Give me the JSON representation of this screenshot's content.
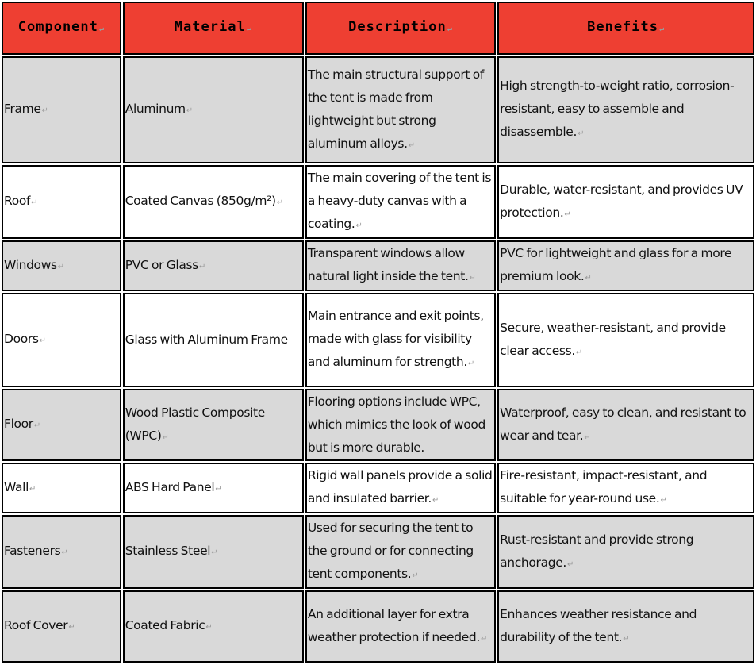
{
  "table": {
    "header_color": "#EE3F32",
    "row_colors": {
      "gray": "#D9D9D9",
      "white": "#FFFFFF"
    },
    "columns": [
      "Component",
      "Material",
      "Description",
      "Benefits"
    ],
    "rows": [
      {
        "shade": "gray",
        "component": "Frame",
        "material": "Aluminum",
        "description": "The main structural support of the tent is made from lightweight but strong aluminum alloys.",
        "benefits": "High strength-to-weight ratio, corrosion-resistant, easy to assemble and disassemble."
      },
      {
        "shade": "white",
        "component": "Roof",
        "material": "Coated Canvas (850g/m²)",
        "description": "The main covering of the tent is a heavy-duty canvas with a coating.",
        "benefits": "Durable, water-resistant, and provides UV protection."
      },
      {
        "shade": "gray",
        "component": "Windows",
        "material": "PVC or Glass",
        "description": "Transparent windows allow natural light inside the tent.",
        "benefits": "PVC for lightweight and glass for a more premium look."
      },
      {
        "shade": "white",
        "component": "Doors",
        "material": "Glass with Aluminum Frame",
        "description": "Main entrance and exit points, made with glass for visibility and aluminum for strength.",
        "benefits": "Secure, weather-resistant, and provide clear access."
      },
      {
        "shade": "gray",
        "component": "Floor",
        "material": "Wood Plastic Composite (WPC)",
        "description": "Flooring options include WPC, which mimics the look of wood but is more durable.",
        "benefits": "Waterproof, easy to clean, and resistant to wear and tear."
      },
      {
        "shade": "white",
        "component": "Wall",
        "material": "ABS Hard Panel",
        "description": "Rigid wall panels provide a solid and insulated barrier.",
        "benefits": "Fire-resistant, impact-resistant, and suitable for year-round use."
      },
      {
        "shade": "gray",
        "component": "Fasteners",
        "material": "Stainless Steel",
        "description": "Used for securing the tent to the ground or for connecting tent components.",
        "benefits": "Rust-resistant and provide strong anchorage."
      },
      {
        "shade": "gray",
        "component": "Roof Cover",
        "material": "Coated Fabric",
        "description": "An additional layer for extra weather protection if needed.",
        "benefits": "Enhances weather resistance and durability of the tent."
      }
    ]
  }
}
